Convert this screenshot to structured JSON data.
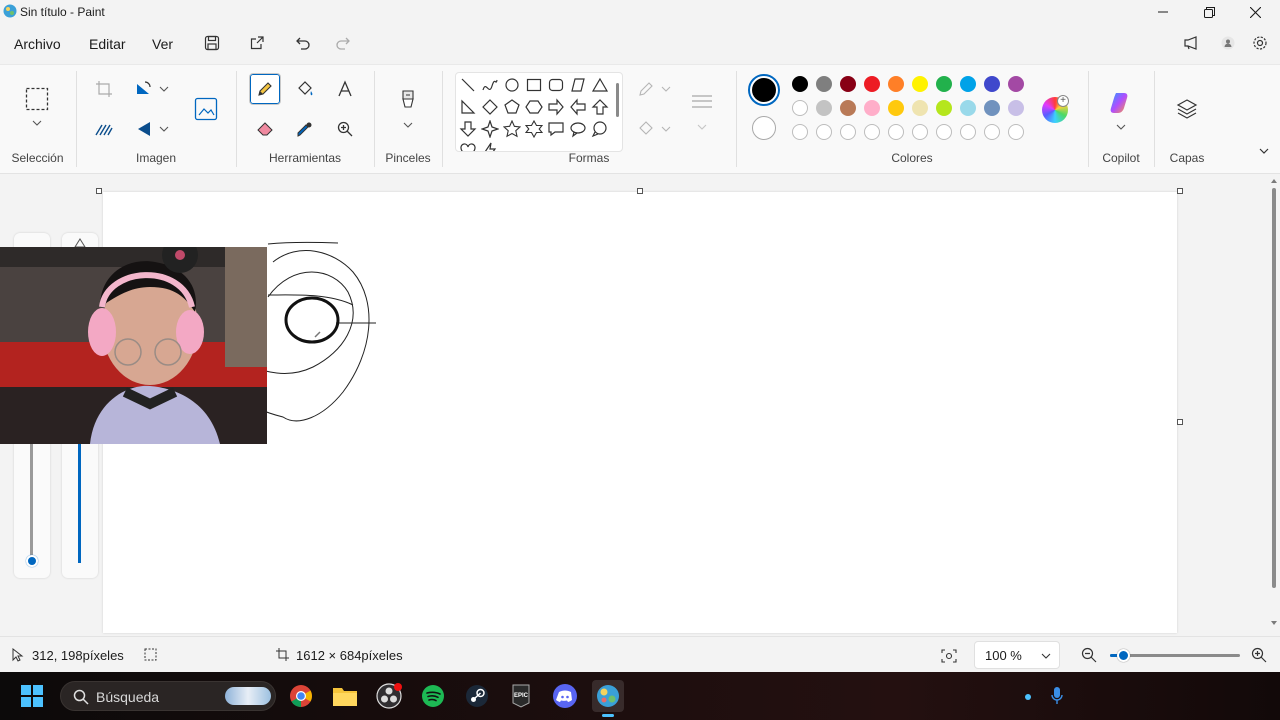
{
  "window": {
    "title": "Sin título - Paint",
    "icons": {
      "app": "paint-icon",
      "minimize": "minimize-icon",
      "maximize": "restore-icon",
      "close": "close-icon"
    }
  },
  "menu": {
    "file": "Archivo",
    "edit": "Editar",
    "view": "Ver",
    "quick_actions": [
      "save-icon",
      "share-icon",
      "undo-icon",
      "redo-icon"
    ],
    "right_icons": [
      "feedback-icon",
      "account-icon",
      "settings-icon"
    ]
  },
  "ribbon": {
    "groups": {
      "selection": "Selección",
      "image": "Imagen",
      "tools": "Herramientas",
      "brushes": "Pinceles",
      "shapes": "Formas",
      "colors": "Colores",
      "copilot": "Copilot",
      "layers": "Capas"
    },
    "active_tool": "pencil",
    "primary_color": "#000000",
    "secondary_color": "#ffffff",
    "palette_row1": [
      "#000000",
      "#7f7f7f",
      "#880015",
      "#ed1c24",
      "#ff7f27",
      "#fff200",
      "#22b14c",
      "#00a2e8",
      "#3f48cc",
      "#a349a4"
    ],
    "palette_row2": [
      "#ffffff",
      "#c3c3c3",
      "#b97a57",
      "#ffaec9",
      "#ffc90e",
      "#efe4b0",
      "#b5e61d",
      "#99d9ea",
      "#7092be",
      "#c8bfe7"
    ]
  },
  "status": {
    "cursor_position": "312, 198píxeles",
    "canvas_size": "1612 × 684píxeles",
    "zoom": "100 %",
    "zoom_fraction": 0.1
  },
  "taskbar": {
    "search_placeholder": "Búsqueda",
    "apps": [
      "windows-start-icon",
      "chrome-icon",
      "file-explorer-icon",
      "obs-icon",
      "spotify-icon",
      "steam-icon",
      "epic-games-icon",
      "discord-icon",
      "paint-icon"
    ]
  }
}
